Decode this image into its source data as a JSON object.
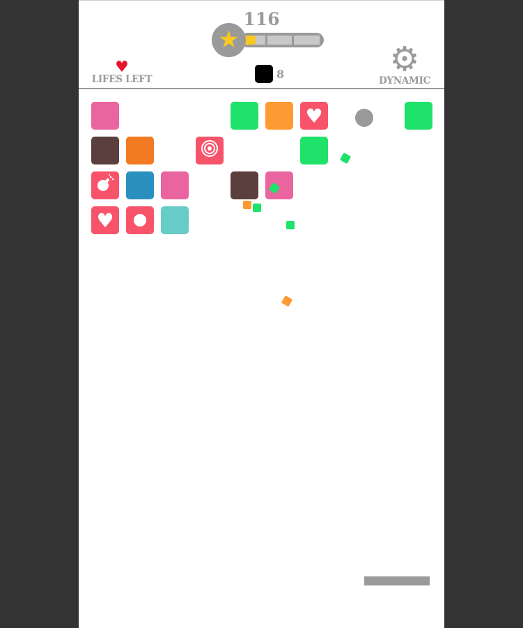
{
  "header": {
    "score": "116",
    "progress_fraction": 0.15,
    "lives_label": "LIFES LEFT",
    "blocks_remaining": "8",
    "mode_label": "DYNAMIC"
  },
  "colors": {
    "pink": "#ea65a0",
    "green": "#1fe26a",
    "orange": "#fd9a33",
    "dark_orange": "#f27a22",
    "brown": "#5a3f3c",
    "red_powerup": "#f7546b",
    "blue": "#2a90bf",
    "teal": "#67cbc7",
    "gray": "#9a9a9a",
    "star": "#f9c821"
  },
  "bricks": [
    {
      "row": 0,
      "col": 0,
      "type": "plain",
      "color": "pink"
    },
    {
      "row": 0,
      "col": 4,
      "type": "plain",
      "color": "green"
    },
    {
      "row": 0,
      "col": 5,
      "type": "plain",
      "color": "orange"
    },
    {
      "row": 0,
      "col": 6,
      "type": "heart-powerup",
      "color": "red_powerup",
      "icon": "heart-icon"
    },
    {
      "row": 0,
      "col": 9,
      "type": "plain",
      "color": "green"
    },
    {
      "row": 1,
      "col": 0,
      "type": "plain",
      "color": "brown"
    },
    {
      "row": 1,
      "col": 1,
      "type": "plain",
      "color": "dark_orange"
    },
    {
      "row": 1,
      "col": 3,
      "type": "target-powerup",
      "color": "red_powerup",
      "icon": "target-icon"
    },
    {
      "row": 1,
      "col": 6,
      "type": "plain",
      "color": "green"
    },
    {
      "row": 2,
      "col": 0,
      "type": "bomb-powerup",
      "color": "red_powerup",
      "icon": "bomb-icon"
    },
    {
      "row": 2,
      "col": 1,
      "type": "plain",
      "color": "blue"
    },
    {
      "row": 2,
      "col": 2,
      "type": "plain",
      "color": "pink"
    },
    {
      "row": 2,
      "col": 4,
      "type": "plain",
      "color": "brown"
    },
    {
      "row": 2,
      "col": 5,
      "type": "plain",
      "color": "pink"
    },
    {
      "row": 3,
      "col": 0,
      "type": "heart-powerup",
      "color": "red_powerup",
      "icon": "heart-icon"
    },
    {
      "row": 3,
      "col": 1,
      "type": "ball-powerup",
      "color": "red_powerup",
      "icon": "ball-icon"
    },
    {
      "row": 3,
      "col": 2,
      "type": "plain",
      "color": "teal"
    }
  ],
  "particles": [
    {
      "color": "green",
      "rotated": true
    },
    {
      "color": "green",
      "rotated": true
    },
    {
      "color": "orange",
      "rotated": false
    },
    {
      "color": "green",
      "rotated": false
    },
    {
      "color": "green",
      "rotated": false
    },
    {
      "color": "orange",
      "rotated": true
    }
  ]
}
